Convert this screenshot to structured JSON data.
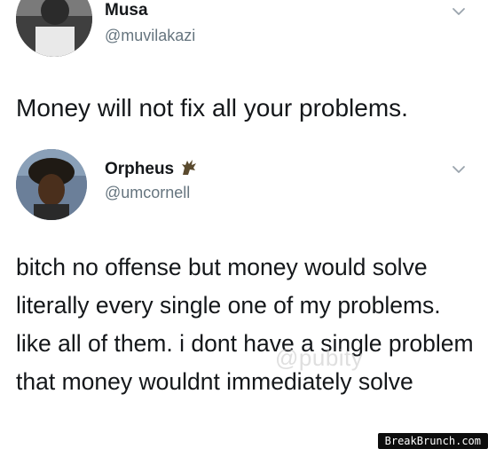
{
  "tweet1": {
    "name": "Musa",
    "handle": "@muvilakazi",
    "text": "Money will not fix all your problems."
  },
  "tweet2": {
    "name": "Orpheus",
    "handle": "@umcornell",
    "text": "bitch no offense but money would solve literally every single one of my problems. like all of them. i dont have a single problem that money wouldnt immediately solve"
  },
  "watermark": "@pubity",
  "brand": "BreakBrunch.com",
  "icons": {
    "chevron": "chevron-down-icon",
    "badge": "rooster-icon"
  },
  "colors": {
    "text": "#14171a",
    "muted": "#66757f",
    "background": "#ffffff"
  }
}
